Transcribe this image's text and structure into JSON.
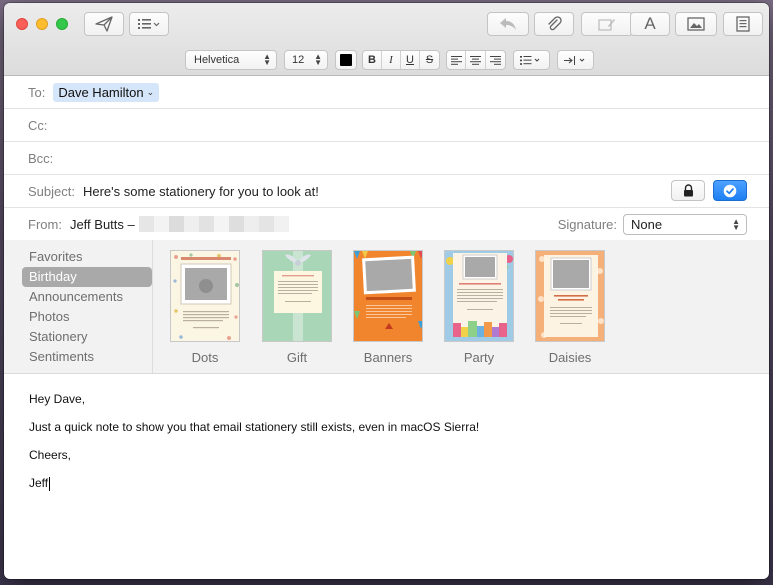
{
  "compose": {
    "to_label": "To:",
    "to_recipient": "Dave Hamilton",
    "cc_label": "Cc:",
    "bcc_label": "Bcc:",
    "subject_label": "Subject:",
    "subject_value": "Here's some stationery for you to look at!",
    "from_label": "From:",
    "from_name": "Jeff Butts –",
    "signature_label": "Signature:",
    "signature_value": "None"
  },
  "format_bar": {
    "font": "Helvetica",
    "size": "12",
    "bold": "B",
    "italic": "I",
    "underline": "U",
    "strike": "S"
  },
  "stationery": {
    "categories": [
      "Favorites",
      "Birthday",
      "Announcements",
      "Photos",
      "Stationery",
      "Sentiments"
    ],
    "selected_category": "Birthday",
    "templates": [
      "Dots",
      "Gift",
      "Banners",
      "Party",
      "Daisies"
    ]
  },
  "message": {
    "greeting": "Hey Dave,",
    "line1": "Just a quick note to show you that email stationery still exists, even in macOS Sierra!",
    "closing": "Cheers,",
    "signoff": "Jeff"
  },
  "colors": {
    "selection": "#d6e6fa",
    "accent_blue": "#1d7ff2",
    "category_selected": "#a9a9a9"
  }
}
